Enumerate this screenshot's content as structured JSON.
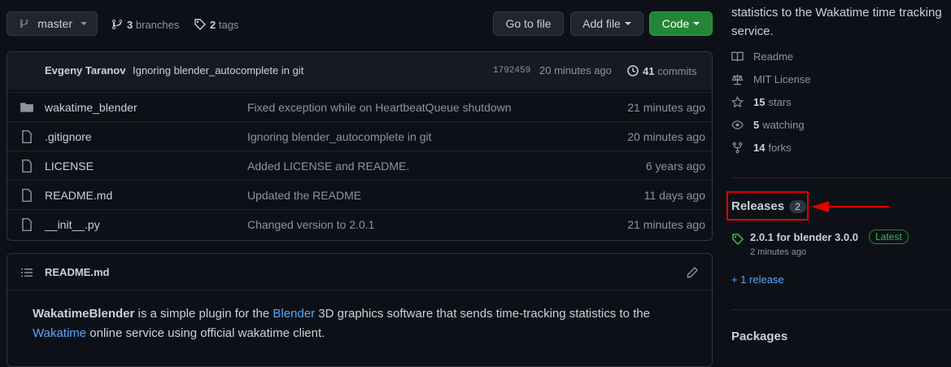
{
  "toolbar": {
    "branch": "master",
    "branches_count": "3",
    "branches_label": "branches",
    "tags_count": "2",
    "tags_label": "tags",
    "go_to_file": "Go to file",
    "add_file": "Add file",
    "code": "Code"
  },
  "commit_bar": {
    "author": "Evgeny Taranov",
    "message": "Ignoring blender_autocomplete in git",
    "sha": "1792459",
    "time": "20 minutes ago",
    "commits_count": "41",
    "commits_label": "commits"
  },
  "files": [
    {
      "name": "wakatime_blender",
      "type": "folder",
      "message": "Fixed exception while on HeartbeatQueue shutdown",
      "age": "21 minutes ago"
    },
    {
      "name": ".gitignore",
      "type": "file",
      "message": "Ignoring blender_autocomplete in git",
      "age": "20 minutes ago"
    },
    {
      "name": "LICENSE",
      "type": "file",
      "message": "Added LICENSE and README.",
      "age": "6 years ago"
    },
    {
      "name": "README.md",
      "type": "file",
      "message": "Updated the README",
      "age": "11 days ago"
    },
    {
      "name": "__init__.py",
      "type": "file",
      "message": "Changed version to 2.0.1",
      "age": "21 minutes ago"
    }
  ],
  "readme": {
    "title": "README.md",
    "p1_strong": "WakatimeBlender",
    "p1_a": " is a simple plugin for the ",
    "p1_link1": "Blender",
    "p1_b": " 3D graphics software that sends time-tracking statistics to the",
    "p1_link2": "Wakatime",
    "p1_c": " online service using official wakatime client."
  },
  "sidebar": {
    "about_line1": "statistics to the Wakatime time tracking",
    "about_line2": "service.",
    "readme": "Readme",
    "license": "MIT License",
    "stars_count": "15",
    "stars_label": "stars",
    "watching_count": "5",
    "watching_label": "watching",
    "forks_count": "14",
    "forks_label": "forks",
    "releases_title": "Releases",
    "releases_count": "2",
    "release_name": "2.0.1 for blender 3.0.0",
    "release_badge": "Latest",
    "release_time": "2 minutes ago",
    "more_releases": "+ 1 release",
    "packages_title": "Packages"
  },
  "colors": {
    "accent": "#58a6ff",
    "green": "#238636",
    "annotation": "#e00000"
  }
}
